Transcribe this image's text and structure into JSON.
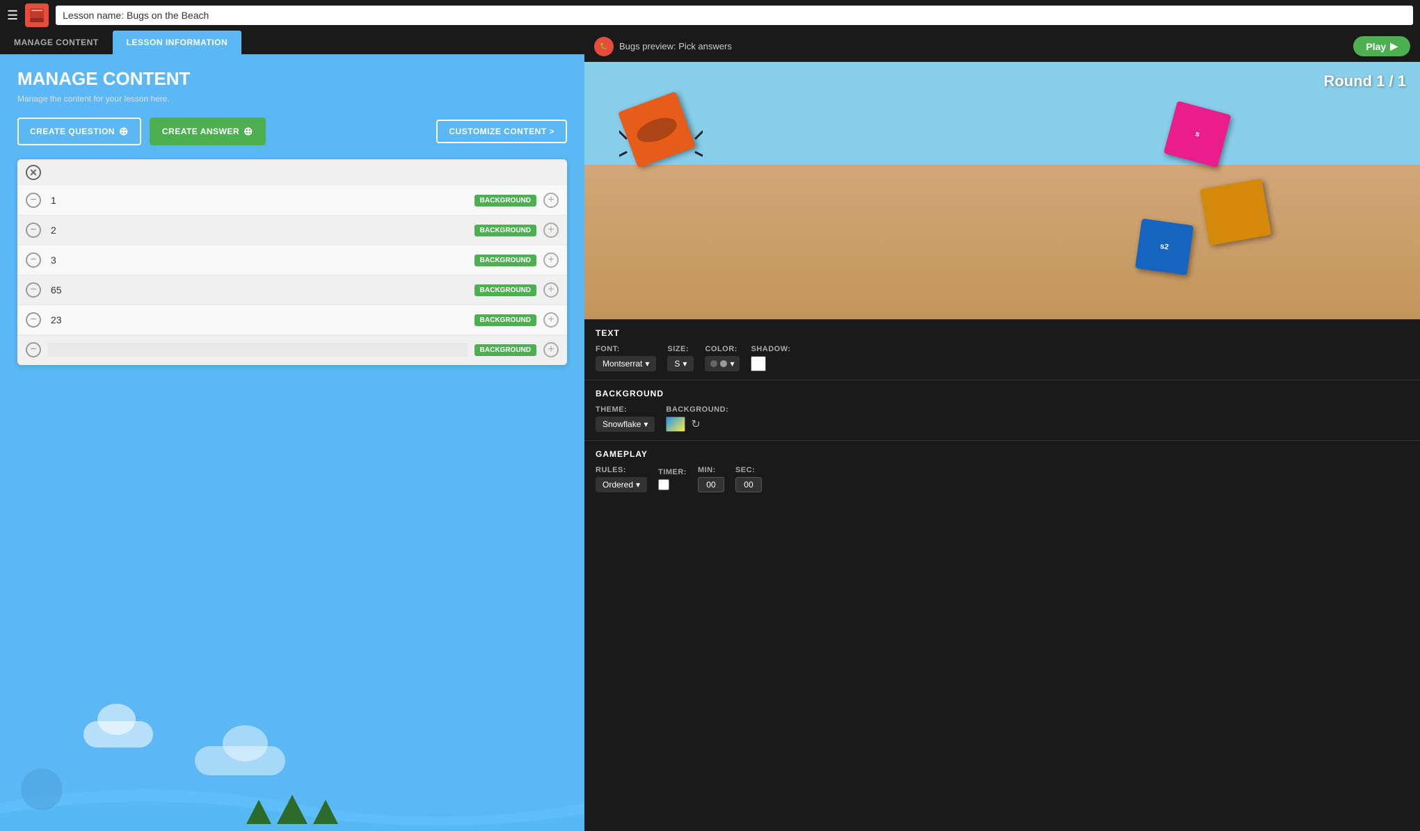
{
  "topBar": {
    "lessonNamePlaceholder": "Lesson name: Bugs on the Beach",
    "lessonNameValue": "Bugs on the Beach"
  },
  "tabs": [
    {
      "id": "manage-content",
      "label": "MANAGE CONTENT",
      "active": false
    },
    {
      "id": "lesson-information",
      "label": "LESSON INFORMATION",
      "active": true
    }
  ],
  "manageContent": {
    "title": "MANAGE CONTENT",
    "subtitle": "Manage the content for your lesson here.",
    "createQuestionLabel": "CREATE QUESTION",
    "createAnswerLabel": "CREATE ANSWER",
    "customizeContentLabel": "CUSTOMIZE CONTENT >",
    "answers": [
      {
        "id": 1,
        "value": "1"
      },
      {
        "id": 2,
        "value": "2"
      },
      {
        "id": 3,
        "value": "3"
      },
      {
        "id": 4,
        "value": "65"
      },
      {
        "id": 5,
        "value": "23"
      },
      {
        "id": 6,
        "value": ""
      }
    ],
    "backgroundBadge": "BACKGROUND"
  },
  "preview": {
    "label": "Bugs preview: Pick answers",
    "roundLabel": "Round 1 / 1",
    "playButton": "Play"
  },
  "textSettings": {
    "sectionTitle": "TEXT",
    "fontLabel": "FONT:",
    "fontValue": "Montserrat",
    "sizeLabel": "SIZE:",
    "sizeValue": "S",
    "colorLabel": "COLOR:",
    "shadowLabel": "SHADOW:"
  },
  "backgroundSettings": {
    "sectionTitle": "BACKGROUND",
    "themeLabel": "THEME:",
    "themeValue": "Snowflake",
    "backgroundLabel": "BACKGROUND:"
  },
  "gameplaySettings": {
    "sectionTitle": "GAMEPLAY",
    "rulesLabel": "RULES:",
    "rulesValue": "Ordered",
    "timerLabel": "TIMER:",
    "minLabel": "MIN:",
    "secLabel": "SEC:",
    "minValue": "00",
    "secValue": "00"
  }
}
